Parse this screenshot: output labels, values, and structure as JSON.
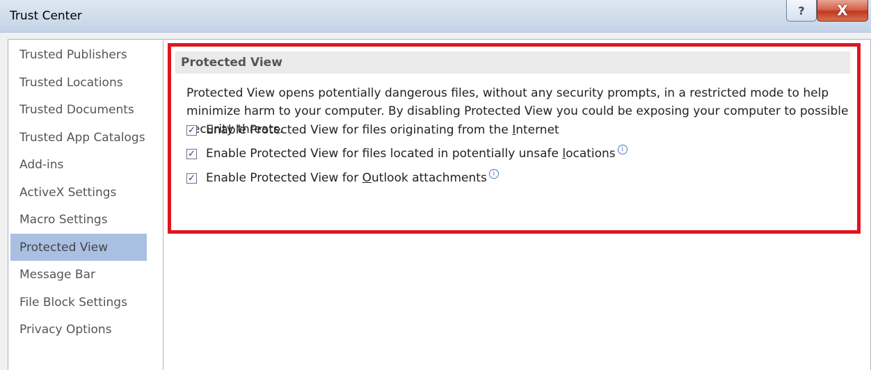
{
  "window": {
    "title": "Trust Center",
    "help_glyph": "?",
    "close_glyph": "X"
  },
  "sidebar": {
    "items": [
      {
        "label": "Trusted Publishers"
      },
      {
        "label": "Trusted Locations"
      },
      {
        "label": "Trusted Documents"
      },
      {
        "label": "Trusted App Catalogs"
      },
      {
        "label": "Add-ins"
      },
      {
        "label": "ActiveX Settings"
      },
      {
        "label": "Macro Settings"
      },
      {
        "label": "Protected View",
        "selected": true
      },
      {
        "label": "Message Bar"
      },
      {
        "label": "File Block Settings"
      },
      {
        "label": "Privacy Options"
      }
    ]
  },
  "main": {
    "section_title": "Protected View",
    "description": "Protected View opens potentially dangerous files, without any security prompts, in a restricted mode to help minimize harm to your computer. By disabling Protected View you could be exposing your computer to possible security threats.",
    "options": [
      {
        "pre": "Enable Protected View for files originating from the ",
        "accel": "I",
        "post": "nternet",
        "checked": true,
        "info": false
      },
      {
        "pre": "Enable Protected View for files located in potentially unsafe ",
        "accel": "l",
        "post": "ocations",
        "checked": true,
        "info": true
      },
      {
        "pre": "Enable Protected View for ",
        "accel": "O",
        "post": "utlook attachments",
        "checked": true,
        "info": true
      }
    ],
    "check_glyph": "✓",
    "info_glyph": "i"
  },
  "colors": {
    "selected_item": "#a9c0e2",
    "highlight_border": "#e0151f",
    "close_button": "#c0391f"
  }
}
